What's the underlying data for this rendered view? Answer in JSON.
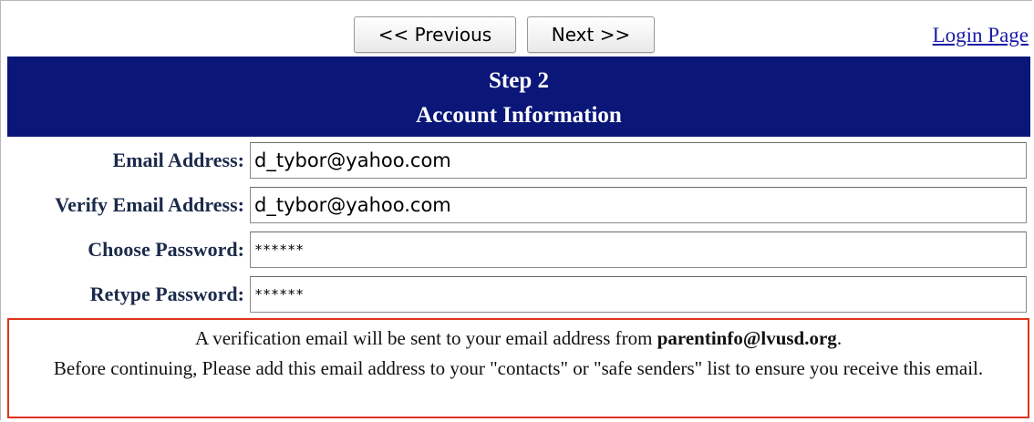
{
  "nav": {
    "previous_label": "<< Previous",
    "next_label": "Next >>",
    "login_label": "Login Page"
  },
  "header": {
    "step": "Step 2",
    "title": "Account Information"
  },
  "form": {
    "email_label": "Email Address:",
    "email_value": "d_tybor@yahoo.com",
    "verify_email_label": "Verify Email Address:",
    "verify_email_value": "d_tybor@yahoo.com",
    "password_label": "Choose Password:",
    "password_value": "******",
    "retype_password_label": "Retype Password:",
    "retype_password_value": "******"
  },
  "notice": {
    "line1_pre": "A verification email will be sent to your email address from ",
    "line1_email": "parentinfo@lvusd.org",
    "line1_post": ".",
    "line2": "Before continuing, Please add this email address to your \"contacts\" or \"safe senders\" list to ensure you receive this email."
  },
  "colors": {
    "header_bg": "#0b1679",
    "notice_border": "#e0331b",
    "link": "#1a1aa6"
  }
}
